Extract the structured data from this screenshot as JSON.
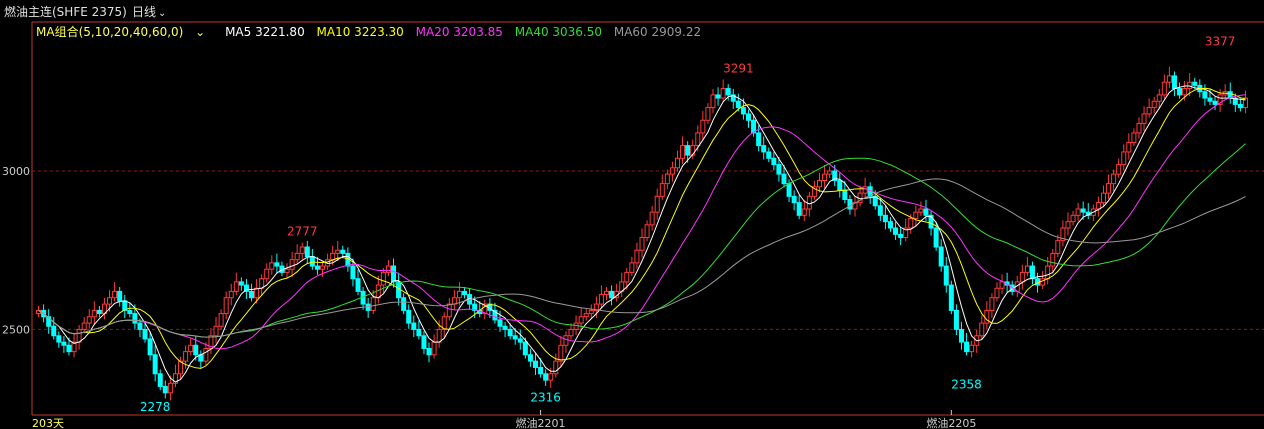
{
  "header": {
    "title": "燃油主连(SHFE 2375)",
    "period": "日线"
  },
  "ma_legend": {
    "combo": "MA组合(5,10,20,40,60,0)",
    "items": [
      {
        "label": "MA5 3221.80",
        "color": "#ffffff"
      },
      {
        "label": "MA10 3223.30",
        "color": "#ffff00"
      },
      {
        "label": "MA20 3203.85",
        "color": "#ff33ff"
      },
      {
        "label": "MA40 3036.50",
        "color": "#33dd33"
      },
      {
        "label": "MA60 2909.22",
        "color": "#999999"
      }
    ]
  },
  "colors": {
    "up": "#ff3b3b",
    "down": "#00ffff",
    "grid": "#8b1a1a",
    "axis": "#c0392b",
    "ma5": "#ffffff",
    "ma10": "#ffff00",
    "ma20": "#ff33ff",
    "ma40": "#33dd33",
    "ma60": "#999999"
  },
  "chart_data": {
    "type": "candlestick",
    "y_ticks": [
      2500,
      3000
    ],
    "ylim": [
      2230,
      3470
    ],
    "bar_count_label": "203天",
    "x_labels": [
      {
        "index": 99,
        "label": "燃油2201"
      },
      {
        "index": 180,
        "label": "燃油2205"
      }
    ],
    "extreme_labels": [
      {
        "index": 23,
        "value": 2278,
        "text": "2278",
        "kind": "low"
      },
      {
        "index": 52,
        "value": 2777,
        "text": "2777",
        "kind": "high"
      },
      {
        "index": 100,
        "value": 2316,
        "text": "2316",
        "kind": "low"
      },
      {
        "index": 138,
        "value": 3291,
        "text": "3291",
        "kind": "high"
      },
      {
        "index": 183,
        "value": 2358,
        "text": "2358",
        "kind": "low"
      },
      {
        "index": 233,
        "value": 3377,
        "text": "3377",
        "kind": "high"
      }
    ],
    "closes": [
      2560,
      2540,
      2510,
      2480,
      2460,
      2450,
      2430,
      2460,
      2500,
      2520,
      2540,
      2560,
      2550,
      2580,
      2600,
      2620,
      2590,
      2560,
      2550,
      2520,
      2500,
      2470,
      2420,
      2360,
      2320,
      2300,
      2330,
      2360,
      2400,
      2430,
      2450,
      2420,
      2400,
      2440,
      2480,
      2510,
      2550,
      2600,
      2620,
      2650,
      2640,
      2620,
      2600,
      2630,
      2660,
      2690,
      2710,
      2700,
      2680,
      2690,
      2720,
      2740,
      2760,
      2730,
      2700,
      2690,
      2700,
      2720,
      2740,
      2750,
      2740,
      2700,
      2660,
      2620,
      2580,
      2560,
      2600,
      2640,
      2680,
      2700,
      2650,
      2600,
      2560,
      2520,
      2500,
      2480,
      2440,
      2420,
      2460,
      2500,
      2540,
      2580,
      2600,
      2620,
      2610,
      2580,
      2560,
      2550,
      2580,
      2560,
      2530,
      2510,
      2500,
      2480,
      2470,
      2460,
      2420,
      2400,
      2380,
      2360,
      2340,
      2360,
      2400,
      2450,
      2480,
      2500,
      2520,
      2540,
      2550,
      2560,
      2580,
      2610,
      2620,
      2600,
      2620,
      2650,
      2680,
      2710,
      2750,
      2790,
      2830,
      2870,
      2920,
      2960,
      2990,
      3010,
      3040,
      3080,
      3050,
      3080,
      3120,
      3160,
      3200,
      3240,
      3230,
      3260,
      3240,
      3220,
      3200,
      3180,
      3160,
      3120,
      3080,
      3060,
      3040,
      3020,
      2990,
      2960,
      2920,
      2900,
      2860,
      2880,
      2920,
      2950,
      2970,
      2990,
      3000,
      2970,
      2940,
      2910,
      2880,
      2900,
      2930,
      2950,
      2920,
      2890,
      2860,
      2840,
      2820,
      2800,
      2790,
      2820,
      2850,
      2870,
      2880,
      2860,
      2820,
      2760,
      2700,
      2640,
      2560,
      2500,
      2460,
      2430,
      2450,
      2480,
      2520,
      2560,
      2600,
      2630,
      2650,
      2640,
      2620,
      2650,
      2680,
      2700,
      2660,
      2640,
      2660,
      2700,
      2740,
      2780,
      2820,
      2840,
      2860,
      2880,
      2870,
      2860,
      2880,
      2900,
      2930,
      2960,
      2990,
      3020,
      3060,
      3090,
      3120,
      3150,
      3180,
      3200,
      3220,
      3240,
      3280,
      3300,
      3260,
      3240,
      3260,
      3280,
      3270,
      3250,
      3230,
      3220,
      3210,
      3240,
      3250,
      3230,
      3210,
      3200,
      3230
    ],
    "series": [
      {
        "name": "MA5",
        "period": 5,
        "color": "#ffffff"
      },
      {
        "name": "MA10",
        "period": 10,
        "color": "#ffff00"
      },
      {
        "name": "MA20",
        "period": 20,
        "color": "#ff33ff"
      },
      {
        "name": "MA40",
        "period": 40,
        "color": "#33dd33"
      },
      {
        "name": "MA60",
        "period": 60,
        "color": "#999999"
      }
    ]
  }
}
